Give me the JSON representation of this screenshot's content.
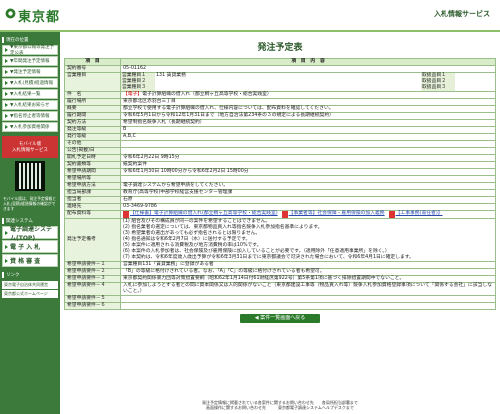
{
  "header": {
    "site_title": "東京都",
    "service_label": "入札情報サービス"
  },
  "sidebar": {
    "section1": "現在の位置",
    "items": [
      "▼東京都公報等発注予定公表",
      "▼年間発注予定情報",
      "▼発注予定情報",
      "▼入札(見積)経過情報",
      "▼入札結果一覧",
      "▼入札結果お知らせ",
      "▼指名停止者等情報",
      "▼入札参加資格関係"
    ],
    "mobile_title": "モバイル版",
    "mobile_sub": "入札情報サービス",
    "mobile_note": "モバイル版は、発注予定情報と入札(見積)経過情報の確認ができます",
    "section2": "関連システム",
    "big_items": [
      "電子調達システム(TOP)",
      "電 子 入 札",
      "資 格 審 査"
    ],
    "section3": "リンク",
    "links": [
      "東京電子自治体共同運営",
      "東京都公式ホームページ"
    ]
  },
  "main": {
    "title": "発注予定表",
    "col_item": "項　目",
    "col_content": "項　目　内　容",
    "rows": [
      {
        "label": "契約番号",
        "value": "05-01162"
      },
      {
        "label": "営業種目",
        "types": [
          {
            "k": "営業種目１",
            "v": "131 賃貸業務",
            "k2": "取扱品目１",
            "v2": ""
          },
          {
            "k": "営業種目２",
            "v": "",
            "k2": "取扱品目２",
            "v2": ""
          },
          {
            "k": "営業種目３",
            "v": "",
            "k2": "取扱品目３",
            "v2": ""
          }
        ]
      },
      {
        "label": "件　名",
        "prefix": "【電子】",
        "value": "電子計算組織の借入れ（都立桐ヶ丘高等学校・総合実践室）"
      },
      {
        "label": "履行場所",
        "value": "東京都北区赤羽台三丁目"
      },
      {
        "label": "概要",
        "value": "都立学校で使用する電子計算組織の借入れ、仕様内容については、配布資料を確認してください。"
      },
      {
        "label": "履行期間",
        "value": "令和6年5月1日から令和12年1月31日まで（地方自治法第234条の３の規定による長期継続契約）"
      },
      {
        "label": "契約方法",
        "value": "希望制指名競争入札（長期継続契約）"
      },
      {
        "label": "発注等級",
        "value": "B"
      },
      {
        "label": "発行等級",
        "value": "A,B,C"
      },
      {
        "label": "その他",
        "value": ""
      },
      {
        "label": "公告(掲載)日",
        "value": ""
      },
      {
        "label": "開札予定日時",
        "value": "令和6年2月22日 9時15分"
      },
      {
        "label": "契約書類等",
        "value": "紙契約案件"
      },
      {
        "label": "希望申請期間",
        "value": "令和6年1月30日 10時00分から令和6年2月2日 15時00分"
      },
      {
        "label": "希望場所等",
        "value": ""
      },
      {
        "label": "希望申請方法",
        "value": "電子調達システムから希望申請をしてください。"
      },
      {
        "label": "担当局部課",
        "value": "教育庁(高等学校)中部学校経営支援センター管理課"
      },
      {
        "label": "担当者",
        "value": "石原"
      },
      {
        "label": "連絡先",
        "value": "03-3469-9786"
      }
    ],
    "attachments_label": "配布資料等",
    "attachments": [
      "【仕様書】電子計算組織の借入れ(都立桐ヶ丘高等学校・総合実践室)",
      "【事業者等】社会保障・雇用保険の加入義務",
      "【工事事務(責任者)】"
    ],
    "conditions_label": "発注予定備考",
    "conditions": [
      "(1) 組合及びその構成員が同一の案件を希望することはできません。",
      "(2) 指名業者の選定については、東京都物品買入れ等指名競争入札参加指名基準によります。",
      "(3) 希望業者の選出があっても必ず指名されるとは限りません。",
      "(4) 指名通知は令和6年2月7日（水）に送付する予定です。",
      "(5) 本案件に適用される消費税及び地方消費税の率は10%です。",
      "(6) 本案件の入札参加者は、社会保険及び雇用保険に加入していることが必要です。（適用除外「任意適用事業所」を除く。）",
      "(7) 本契約は、令和6年度歳入歳出予算が令和6年3月31日までに東京都議会で可決された場合において、令和6年4月1日に確定します。"
    ],
    "reqs": [
      {
        "label": "希望申請要件－１",
        "value": "営業種目131「賃貸業務」に登録がある者"
      },
      {
        "label": "希望申請要件－２",
        "value": "「B」の等級に格付けされている者。なお、「A」「C」の等級に格付けされている者も希望可。"
      },
      {
        "label": "希望申請要件－３",
        "value": "東京都契約関係暴力団等対策措置要綱（昭和62年1月14日付61財経庶第922号）第5条第1項に基づく排除措置期間中でないこと。"
      },
      {
        "label": "希望申請要件－４",
        "value": "入札に参加しようとする者との間に資本関係又は人的関係がないこと（東京都建設工事等（物品買入れ等）競争入札参加資格登録事項について「関係する会社」に該当しないこと。）"
      },
      {
        "label": "希望申請要件－５",
        "value": ""
      },
      {
        "label": "希望申請要件－６",
        "value": ""
      }
    ],
    "back_button": "◀ 案件一覧画面へ戻る"
  },
  "footer": {
    "line1": "発注予定情報に掲載されている各案件に関するお問い合わせ先　　各局所担当部署まで",
    "line2": "画面操作に関するお問い合わせ先　　　東京都電子調達システムヘルプデスクまで"
  },
  "colors": {
    "accent": "#2a7a2a",
    "sidebar": "#3c7a3c",
    "header_cell": "#d9ecc9"
  }
}
